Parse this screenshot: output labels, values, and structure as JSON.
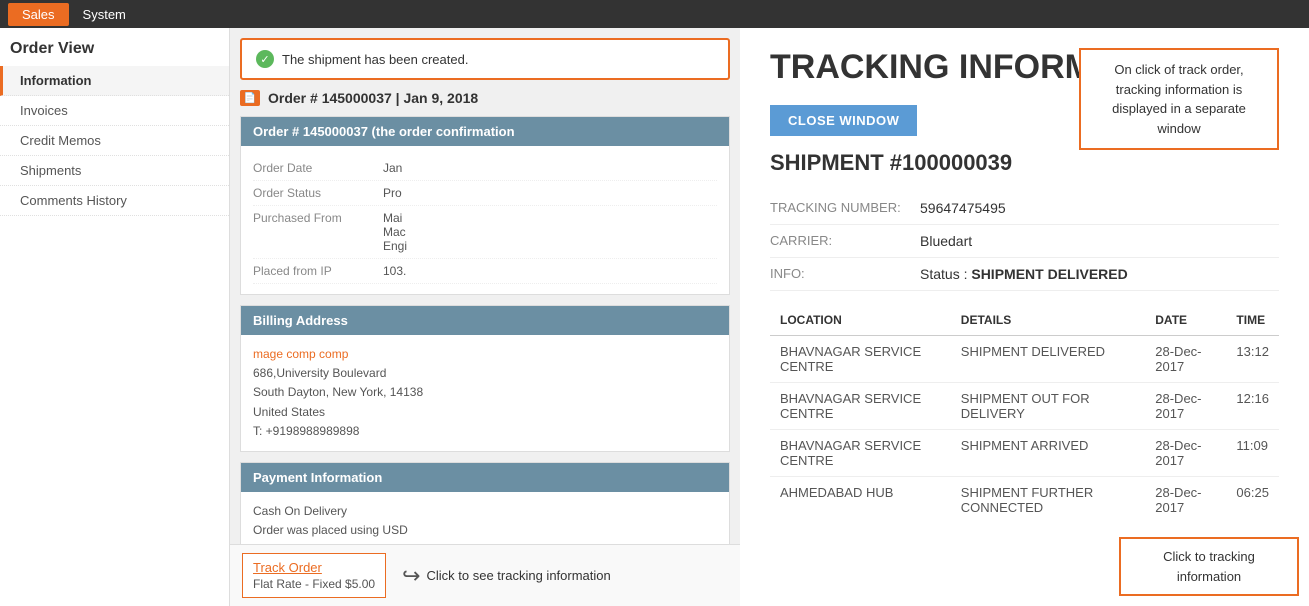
{
  "nav": {
    "tabs": [
      {
        "label": "Sales",
        "active": true
      },
      {
        "label": "System",
        "active": false
      }
    ]
  },
  "sidebar": {
    "title": "Order View",
    "items": [
      {
        "label": "Information",
        "active": true,
        "id": "information"
      },
      {
        "label": "Invoices",
        "active": false,
        "id": "invoices"
      },
      {
        "label": "Credit Memos",
        "active": false,
        "id": "credit-memos"
      },
      {
        "label": "Shipments",
        "active": false,
        "id": "shipments"
      },
      {
        "label": "Comments History",
        "active": false,
        "id": "comments-history"
      }
    ]
  },
  "order": {
    "success_message": "The shipment has been created.",
    "header": "Order # 145000037 | Jan 9, 2018",
    "section_title": "Order # 145000037 (the order confirmation",
    "fields": [
      {
        "label": "Order Date",
        "value": "Jan"
      },
      {
        "label": "Order Status",
        "value": "Pro"
      },
      {
        "label": "Purchased From",
        "value": "Mai\nMac\nEngi"
      },
      {
        "label": "Placed from IP",
        "value": "103."
      }
    ],
    "billing_address": {
      "title": "Billing Address",
      "name": "mage comp comp",
      "street": "686,University Boulevard",
      "city": "South Dayton, New York, 14138",
      "country": "United States",
      "phone": "T: +9198988989898"
    },
    "payment": {
      "title": "Payment Information",
      "method": "Cash On Delivery",
      "note": "Order was placed using USD"
    },
    "track_order_label": "Track Order",
    "track_shipping": "Flat Rate - Fixed $5.00",
    "click_to_tracking": "Click to see tracking information"
  },
  "tracking": {
    "page_title": "TRACKING INFORMATION",
    "close_button": "CLOSE WINDOW",
    "shipment_number": "SHIPMENT #100000039",
    "callout_text": "On click of track order, tracking information is displayed in a separate window",
    "fields": [
      {
        "label": "TRACKING NUMBER:",
        "value": "59647475495"
      },
      {
        "label": "CARRIER:",
        "value": "Bluedart"
      },
      {
        "label": "INFO:",
        "value": "Status : SHIPMENT DELIVERED"
      }
    ],
    "table": {
      "headers": [
        "LOCATION",
        "DETAILS",
        "DATE",
        "TIME"
      ],
      "rows": [
        {
          "location": "BHAVNAGAR SERVICE CENTRE",
          "details": "SHIPMENT DELIVERED",
          "date": "28-Dec-2017",
          "time": "13:12"
        },
        {
          "location": "BHAVNAGAR SERVICE CENTRE",
          "details": "SHIPMENT OUT FOR DELIVERY",
          "date": "28-Dec-2017",
          "time": "12:16"
        },
        {
          "location": "BHAVNAGAR SERVICE CENTRE",
          "details": "SHIPMENT ARRIVED",
          "date": "28-Dec-2017",
          "time": "11:09"
        },
        {
          "location": "AHMEDABAD HUB",
          "details": "SHIPMENT FURTHER CONNECTED",
          "date": "28-Dec-2017",
          "time": "06:25"
        }
      ]
    },
    "bottom_callout": "Click to tracking information"
  }
}
